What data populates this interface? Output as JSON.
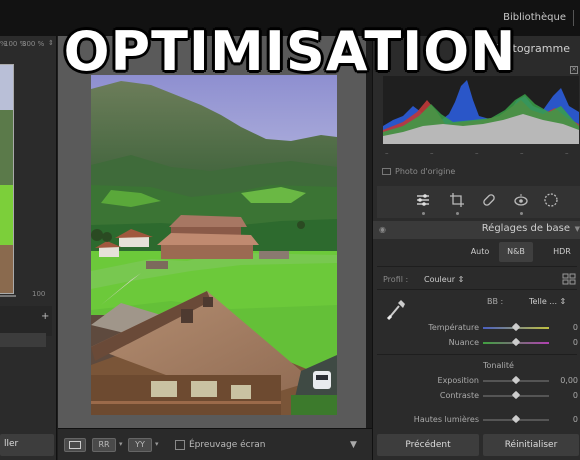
{
  "overlay": {
    "title": "OPTIMISATION"
  },
  "topbar": {
    "module": "Bibliothèque"
  },
  "left_panel": {
    "zoom_left": "% ",
    "zoom_mid": "100 %",
    "zoom_right": "300 %",
    "slider_value": "100",
    "add_symbol": "+",
    "bottom_button": "ller"
  },
  "toolbar": {
    "softproof_label": "Épreuvage écran",
    "compare_icon": "RR",
    "survey_icon": "YY"
  },
  "right_panel": {
    "histogram_title": "Histogramme",
    "histogram_dashes": [
      "–",
      "–",
      "–",
      "–",
      "–"
    ],
    "photo_origin": "Photo d'origine",
    "section_title": "Réglages de base",
    "modes": [
      "Auto",
      "N&B",
      "HDR"
    ],
    "profile_label": "Profil :",
    "profile_value": "Couleur ⇕",
    "wb_label": "BB :",
    "wb_value": "Telle ... ⇕",
    "sliders": [
      {
        "label": "Température",
        "value": "0",
        "position": 0.5
      },
      {
        "label": "Nuance",
        "value": "0",
        "position": 0.5
      }
    ],
    "tone_heading": "Tonalité",
    "tone_sliders": [
      {
        "label": "Exposition",
        "value": "0,00",
        "position": 0.5
      },
      {
        "label": "Contraste",
        "value": "0",
        "position": 0.5
      },
      {
        "label": "Hautes lumières",
        "value": "0",
        "position": 0.5
      }
    ],
    "prev_button": "Précédent",
    "reset_button": "Réinitialiser"
  },
  "colors": {
    "panel_bg": "#2b2b2b",
    "center_bg": "#5a5a5a",
    "topbar_bg": "#121212",
    "temp_track": "#4a5fc0-#c0c040",
    "tint_track": "#40a040-#b040b0"
  }
}
